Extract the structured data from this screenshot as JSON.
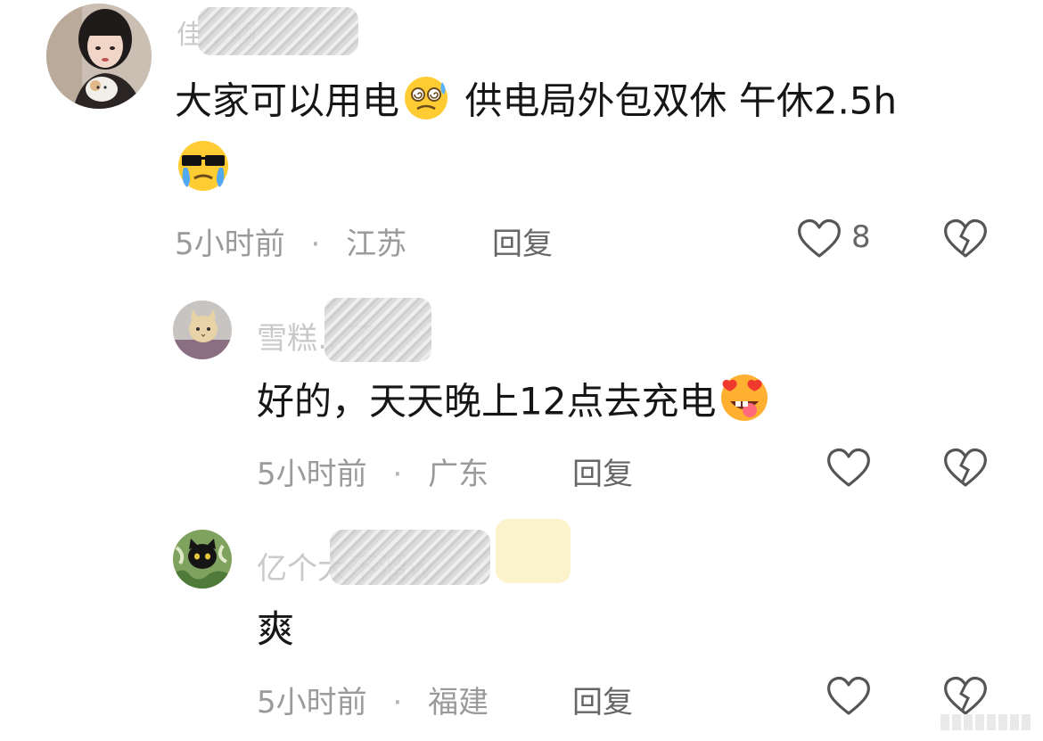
{
  "comments": [
    {
      "username": "佳…啊",
      "text_part1": "大家可以用电",
      "text_part2": " 供电局外包双休 午休2.5h",
      "emoji1": "face-with-spiral-eyes-sweat-emoji",
      "emoji2": "cool-sunglasses-crying-emoji",
      "time": "5小时前",
      "separator": "·",
      "location": "江苏",
      "reply_label": "回复",
      "like_count": "8"
    },
    {
      "username": "雪糕…了",
      "text": "好的，天天晚上12点去充电",
      "emoji": "heart-eyes-tongue-emoji",
      "time": "5小时前",
      "separator": "·",
      "location": "广东",
      "reply_label": "回复"
    },
    {
      "username": "亿个大不溜w",
      "text": "爽",
      "time": "5小时前",
      "separator": "·",
      "location": "福建",
      "reply_label": "回复"
    }
  ]
}
